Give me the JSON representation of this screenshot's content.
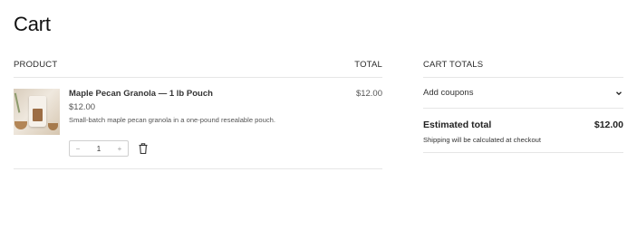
{
  "page": {
    "title": "Cart"
  },
  "table": {
    "headers": {
      "product": "PRODUCT",
      "total": "TOTAL"
    },
    "items": [
      {
        "name": "Maple Pecan Granola — 1 lb Pouch",
        "price": "$12.00",
        "description": "Small-batch maple pecan granola in a one-pound resealable pouch.",
        "quantity": "1",
        "decrement": "−",
        "increment": "+",
        "line_total": "$12.00"
      }
    ]
  },
  "totals": {
    "title": "CART TOTALS",
    "coupons_label": "Add coupons",
    "estimated_label": "Estimated total",
    "estimated_value": "$12.00",
    "shipping_note": "Shipping will be calculated at checkout"
  },
  "icons": {
    "product_thumbnail": "granola-pouch-image",
    "remove": "trash-icon",
    "coupons_toggle": "chevron-down-icon"
  }
}
